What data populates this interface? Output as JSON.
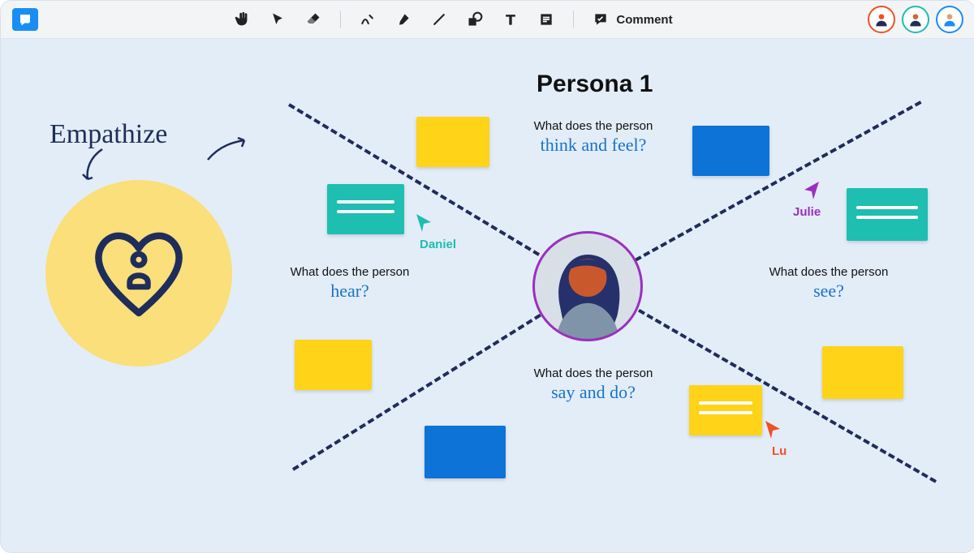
{
  "toolbar": {
    "comment_label": "Comment"
  },
  "canvas": {
    "title": "Persona 1",
    "empathize_label": "Empathize",
    "quadrants": {
      "top": {
        "line1": "What does the person",
        "line2": "think and feel?"
      },
      "left": {
        "line1": "What does the person",
        "line2": "hear?"
      },
      "right": {
        "line1": "What does the person",
        "line2": "see?"
      },
      "bottom": {
        "line1": "What does the person",
        "line2": "say and do?"
      }
    },
    "cursors": {
      "daniel": {
        "name": "Daniel",
        "color": "#1ebeb0"
      },
      "julie": {
        "name": "Julie",
        "color": "#9b2fbf"
      },
      "lu": {
        "name": "Lu",
        "color": "#f05123"
      }
    },
    "collaborators": [
      {
        "border": "#f05123"
      },
      {
        "border": "#1ebeb0"
      },
      {
        "border": "#188ef5"
      }
    ]
  }
}
